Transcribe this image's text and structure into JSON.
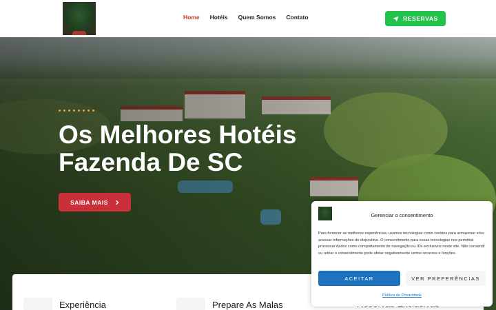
{
  "header": {
    "logo_alt": "logo",
    "nav": [
      {
        "label": "Home",
        "active": true
      },
      {
        "label": "Hotéis",
        "active": false
      },
      {
        "label": "Quem Somos",
        "active": false
      },
      {
        "label": "Contato",
        "active": false
      }
    ],
    "reservas_label": "RESERVAS",
    "reservas_icon": "paper-plane-icon",
    "accent_green": "#21c34b",
    "accent_red": "#c0392b"
  },
  "hero": {
    "title_line1": "Os Melhores Hotéis",
    "title_line2": "Fazenda De SC",
    "cta_label": "SAIBA MAIS",
    "cta_icon": "chevron-right-icon",
    "cta_color": "#c9303a",
    "decoration_dots": 8
  },
  "cards": [
    {
      "title": "Experiência"
    },
    {
      "title": "Prepare As Malas"
    },
    {
      "title": "Reservas Exclusivas"
    }
  ],
  "cookie": {
    "title": "Gerenciar o consentimento",
    "text": "Para fornecer as melhores experiências, usamos tecnologias como cookies para armazenar e/ou acessar informações do dispositivo. O consentimento para essas tecnologias nos permitirá processar dados como comportamento de navegação ou IDs exclusivos neste site. Não consentir ou retirar o consentimento pode afetar negativamente certos recursos e funções.",
    "accept_label": "ACEITAR",
    "prefs_label": "VER PREFERÊNCIAS",
    "privacy_label": "Política de Privacidade"
  }
}
